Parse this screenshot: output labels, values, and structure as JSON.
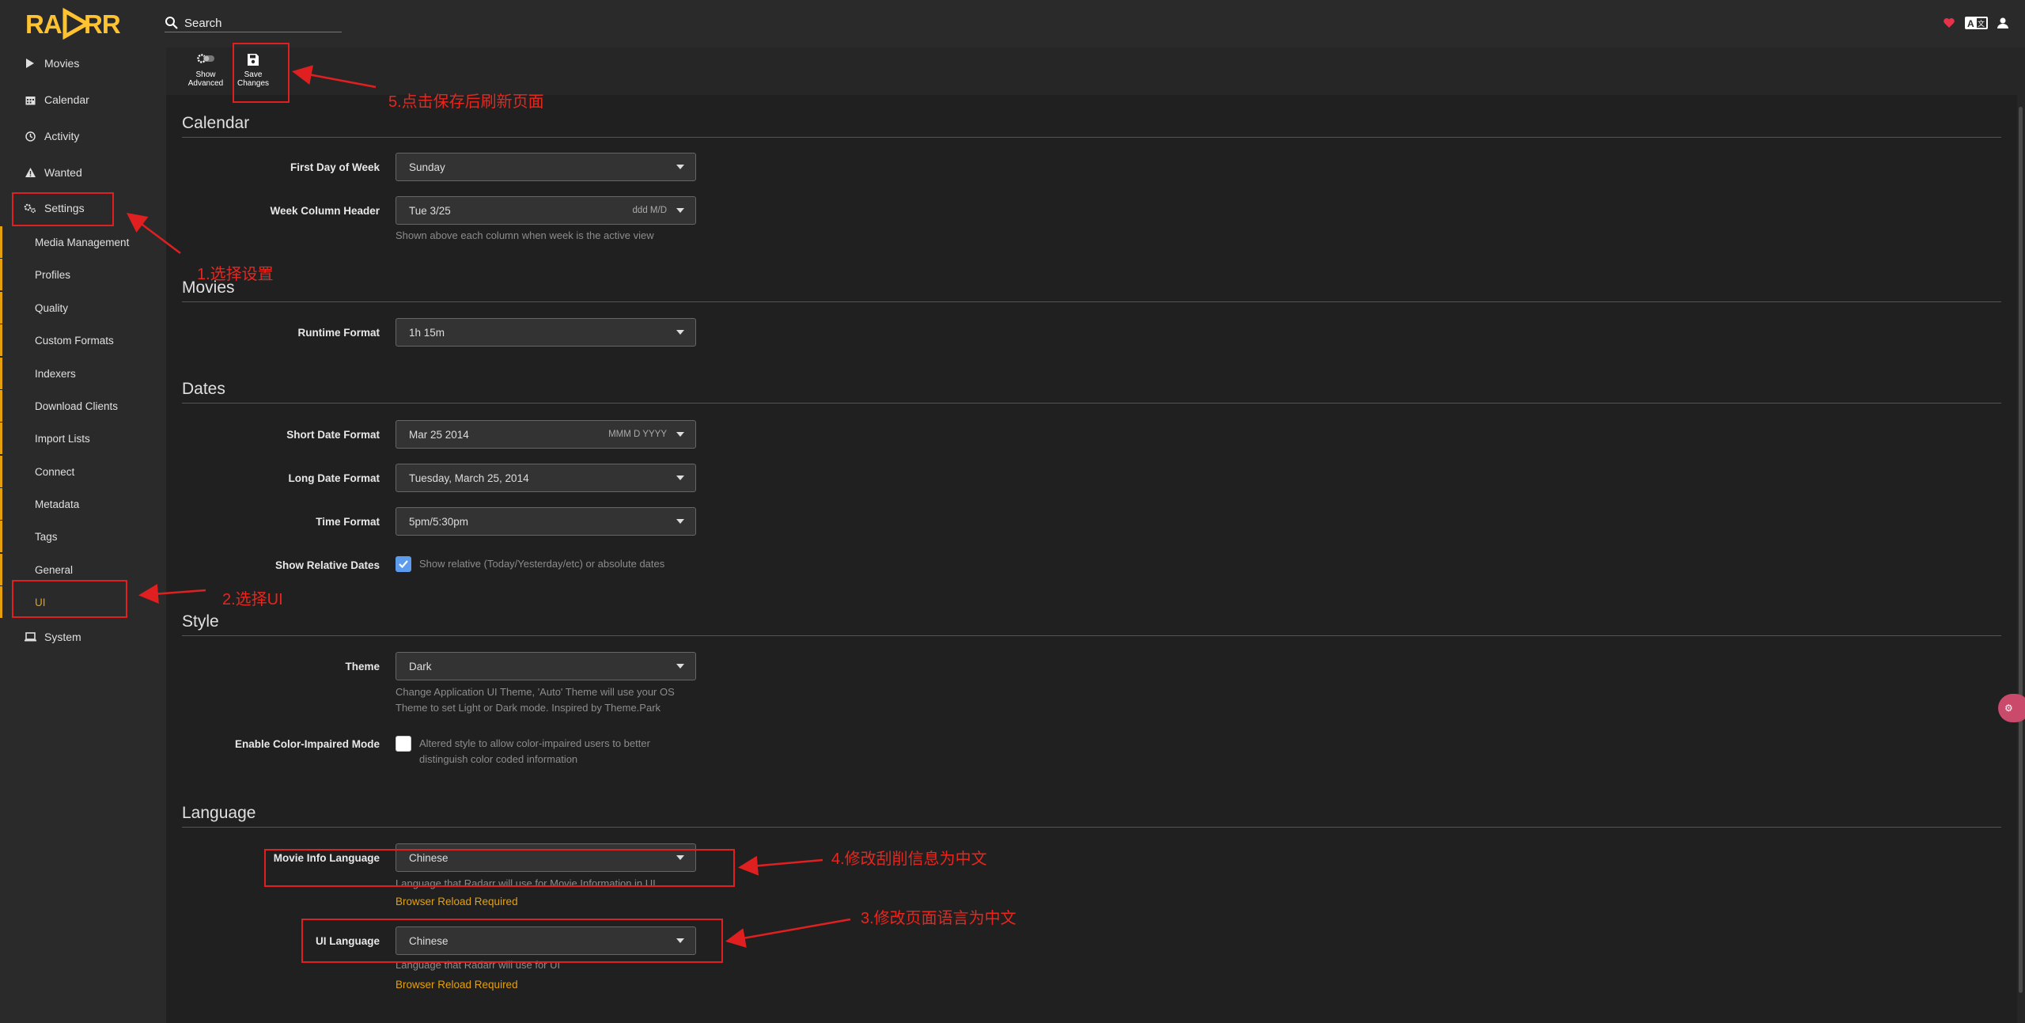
{
  "header": {
    "logo_text": "RADARR",
    "search_placeholder": "Search",
    "icons": [
      "heart-icon",
      "translate-icon",
      "user-icon"
    ]
  },
  "sidebar": {
    "items": [
      {
        "label": "Movies",
        "icon": "play-icon"
      },
      {
        "label": "Calendar",
        "icon": "calendar-icon"
      },
      {
        "label": "Activity",
        "icon": "clock-icon"
      },
      {
        "label": "Wanted",
        "icon": "warning-icon"
      },
      {
        "label": "Settings",
        "icon": "gears-icon"
      }
    ],
    "settings_children": [
      "Media Management",
      "Profiles",
      "Quality",
      "Custom Formats",
      "Indexers",
      "Download Clients",
      "Import Lists",
      "Connect",
      "Metadata",
      "Tags",
      "General",
      "UI"
    ],
    "active_child": "UI",
    "system": {
      "label": "System",
      "icon": "laptop-icon"
    }
  },
  "toolbar": {
    "show_advanced": [
      "Show",
      "Advanced"
    ],
    "save_changes": [
      "Save",
      "Changes"
    ]
  },
  "sections": {
    "calendar": {
      "title": "Calendar",
      "first_day_label": "First Day of Week",
      "first_day_value": "Sunday",
      "week_header_label": "Week Column Header",
      "week_header_value": "Tue 3/25",
      "week_header_hint": "ddd M/D",
      "week_header_help": "Shown above each column when week is the active view"
    },
    "movies": {
      "title": "Movies",
      "runtime_label": "Runtime Format",
      "runtime_value": "1h 15m"
    },
    "dates": {
      "title": "Dates",
      "short_label": "Short Date Format",
      "short_value": "Mar 25 2014",
      "short_hint": "MMM D YYYY",
      "long_label": "Long Date Format",
      "long_value": "Tuesday, March 25, 2014",
      "time_label": "Time Format",
      "time_value": "5pm/5:30pm",
      "relative_label": "Show Relative Dates",
      "relative_help": "Show relative (Today/Yesterday/etc) or absolute dates",
      "relative_checked": true
    },
    "style": {
      "title": "Style",
      "theme_label": "Theme",
      "theme_value": "Dark",
      "theme_help_1": "Change Application UI Theme, 'Auto' Theme will use your OS",
      "theme_help_2": "Theme to set Light or Dark mode. Inspired by Theme.Park",
      "color_label": "Enable Color-Impaired Mode",
      "color_help_1": "Altered style to allow color-impaired users to better",
      "color_help_2": "distinguish color coded information",
      "color_checked": false
    },
    "language": {
      "title": "Language",
      "movie_info_label": "Movie Info Language",
      "movie_info_value": "Chinese",
      "movie_info_help": "Language that Radarr will use for Movie Information in UI",
      "movie_info_warn": "Browser Reload Required",
      "ui_label": "UI Language",
      "ui_value": "Chinese",
      "ui_help": "Language that Radarr will use for UI",
      "ui_warn": "Browser Reload Required"
    }
  },
  "annotations": {
    "step1": "1.选择设置",
    "step2": "2.选择UI",
    "step3": "3.修改页面语言为中文",
    "step4": "4.修改刮削信息为中文",
    "step5": "5.点击保存后刷新页面"
  },
  "colors": {
    "accent": "#e5a00d",
    "annotation": "#e02020",
    "checkbox": "#5d9cec"
  }
}
